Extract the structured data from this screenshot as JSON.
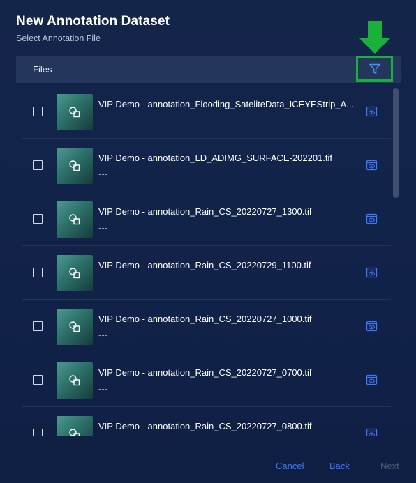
{
  "dialog": {
    "title": "New Annotation Dataset",
    "subtitle": "Select Annotation File"
  },
  "files_header": {
    "label": "Files",
    "filter_icon": "filter-icon"
  },
  "files": [
    {
      "name": "VIP Demo - annotation_Flooding_SateliteData_ICEYEStrip_A...",
      "description": "---"
    },
    {
      "name": "VIP Demo - annotation_LD_ADIMG_SURFACE-202201.tif",
      "description": "---"
    },
    {
      "name": "VIP Demo - annotation_Rain_CS_20220727_1300.tif",
      "description": "---"
    },
    {
      "name": "VIP Demo - annotation_Rain_CS_20220729_1100.tif",
      "description": "---"
    },
    {
      "name": "VIP Demo - annotation_Rain_CS_20220727_1000.tif",
      "description": "---"
    },
    {
      "name": "VIP Demo - annotation_Rain_CS_20220727_0700.tif",
      "description": "---"
    },
    {
      "name": "VIP Demo - annotation_Rain_CS_20220727_0800.tif",
      "description": "---"
    }
  ],
  "footer": {
    "cancel_label": "Cancel",
    "back_label": "Back",
    "next_label": "Next"
  },
  "colors": {
    "accent": "#3f78ff",
    "highlight": "#19b03b",
    "disabled": "#4f5b76"
  }
}
